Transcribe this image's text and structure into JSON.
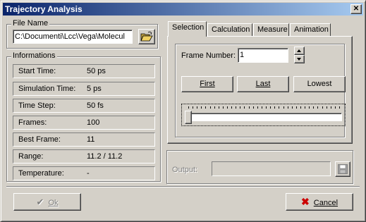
{
  "window": {
    "title": "Trajectory Analysis"
  },
  "file_name": {
    "group_label": "File Name",
    "path": "C:\\Documenti\\Lcc\\Vega\\Molecul"
  },
  "informations": {
    "group_label": "Informations",
    "rows": [
      {
        "label": "Start Time:",
        "value": "50 ps"
      },
      {
        "label": "Simulation Time:",
        "value": "5 ps"
      },
      {
        "label": "Time Step:",
        "value": "50 fs"
      },
      {
        "label": "Frames:",
        "value": "100"
      },
      {
        "label": "Best Frame:",
        "value": "11"
      },
      {
        "label": "Range:",
        "value": "11.2 / 11.2"
      },
      {
        "label": "Temperature:",
        "value": "-"
      }
    ]
  },
  "tabs": [
    {
      "label": "Selection",
      "active": true
    },
    {
      "label": "Calculation",
      "active": false
    },
    {
      "label": "Measure",
      "active": false
    },
    {
      "label": "Animation",
      "active": false
    }
  ],
  "selection": {
    "frame_number_label": "Frame Number:",
    "frame_number_value": "1",
    "first_label": "First",
    "last_label": "Last",
    "lowest_label": "Lowest",
    "slider_position": 0
  },
  "output": {
    "label": "Output:",
    "value": ""
  },
  "footer": {
    "ok_label": "Ok",
    "cancel_label": "Cancel"
  },
  "colors": {
    "titlebar_start": "#0a246a",
    "titlebar_end": "#a6caf0",
    "face": "#d4d0c8",
    "cancel_x": "#cc0000"
  }
}
